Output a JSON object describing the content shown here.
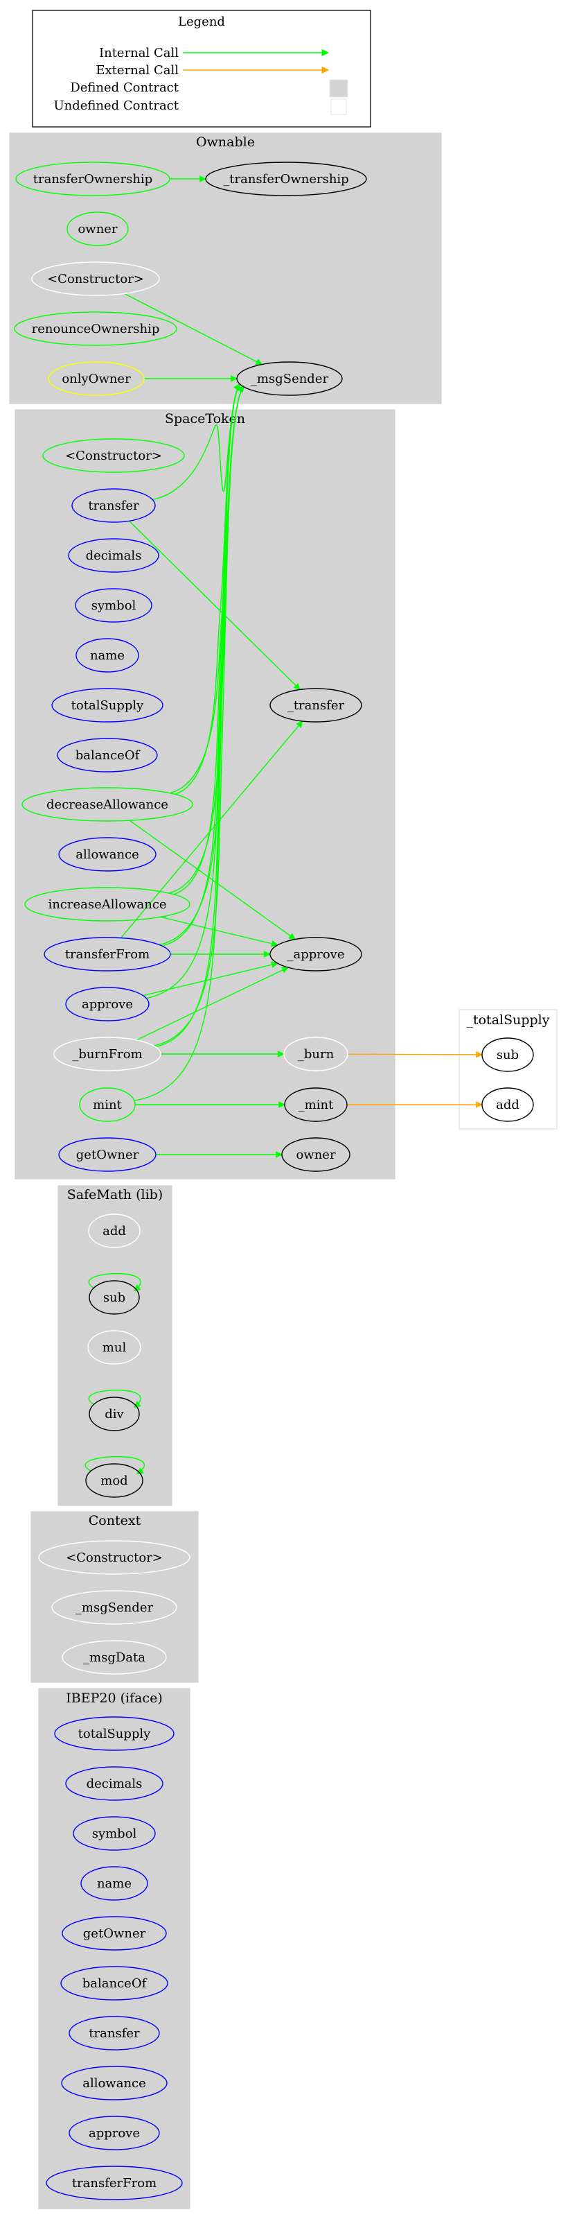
{
  "legend": {
    "title": "Legend",
    "items": [
      {
        "label": "Internal Call",
        "kind": "internal"
      },
      {
        "label": "External Call",
        "kind": "external"
      },
      {
        "label": "Defined Contract",
        "kind": "defined"
      },
      {
        "label": "Undefined Contract",
        "kind": "undefined"
      }
    ]
  },
  "colors": {
    "internal_call": "#00ff00",
    "external_call": "#ffa500",
    "cluster_fill": "#d3d3d3",
    "external_cluster_border": "#e0e0e0",
    "node_public": "#0000ff",
    "node_internal_call": "#00ff00",
    "node_modifier": "#ffff00",
    "node_private": "#ffffff",
    "node_undefined": "#000000"
  },
  "clusters": [
    {
      "id": "Ownable",
      "label": "Ownable",
      "defined": true
    },
    {
      "id": "SpaceToken",
      "label": "SpaceToken",
      "defined": true
    },
    {
      "id": "_totalSupply",
      "label": "_totalSupply",
      "defined": false
    },
    {
      "id": "SafeMath",
      "label": "SafeMath  (lib)",
      "defined": true
    },
    {
      "id": "Context",
      "label": "Context",
      "defined": true
    },
    {
      "id": "IBEP20",
      "label": "IBEP20  (iface)",
      "defined": true
    }
  ],
  "nodes": [
    {
      "id": "own_transferOwnership",
      "cluster": "Ownable",
      "label": "transferOwnership",
      "stroke": "green"
    },
    {
      "id": "own__transferOwnership",
      "cluster": "Ownable",
      "label": "_transferOwnership",
      "stroke": "black"
    },
    {
      "id": "own_owner",
      "cluster": "Ownable",
      "label": "owner",
      "stroke": "green"
    },
    {
      "id": "own_ctor",
      "cluster": "Ownable",
      "label": "<Constructor>",
      "stroke": "white"
    },
    {
      "id": "own_renounce",
      "cluster": "Ownable",
      "label": "renounceOwnership",
      "stroke": "green"
    },
    {
      "id": "own_onlyOwner",
      "cluster": "Ownable",
      "label": "onlyOwner",
      "stroke": "yellow"
    },
    {
      "id": "own__msgSender",
      "cluster": "Ownable",
      "label": "_msgSender",
      "stroke": "black"
    },
    {
      "id": "st_ctor",
      "cluster": "SpaceToken",
      "label": "<Constructor>",
      "stroke": "green"
    },
    {
      "id": "st_transfer",
      "cluster": "SpaceToken",
      "label": "transfer",
      "stroke": "blue"
    },
    {
      "id": "st_decimals",
      "cluster": "SpaceToken",
      "label": "decimals",
      "stroke": "blue"
    },
    {
      "id": "st_symbol",
      "cluster": "SpaceToken",
      "label": "symbol",
      "stroke": "blue"
    },
    {
      "id": "st_name",
      "cluster": "SpaceToken",
      "label": "name",
      "stroke": "blue"
    },
    {
      "id": "st_totalSupply",
      "cluster": "SpaceToken",
      "label": "totalSupply",
      "stroke": "blue"
    },
    {
      "id": "st_balanceOf",
      "cluster": "SpaceToken",
      "label": "balanceOf",
      "stroke": "blue"
    },
    {
      "id": "st_decreaseAllowance",
      "cluster": "SpaceToken",
      "label": "decreaseAllowance",
      "stroke": "green"
    },
    {
      "id": "st_allowance",
      "cluster": "SpaceToken",
      "label": "allowance",
      "stroke": "blue"
    },
    {
      "id": "st_increaseAllowance",
      "cluster": "SpaceToken",
      "label": "increaseAllowance",
      "stroke": "green"
    },
    {
      "id": "st_transferFrom",
      "cluster": "SpaceToken",
      "label": "transferFrom",
      "stroke": "blue"
    },
    {
      "id": "st_approve",
      "cluster": "SpaceToken",
      "label": "approve",
      "stroke": "blue"
    },
    {
      "id": "st__burnFrom",
      "cluster": "SpaceToken",
      "label": "_burnFrom",
      "stroke": "white"
    },
    {
      "id": "st_mint",
      "cluster": "SpaceToken",
      "label": "mint",
      "stroke": "green"
    },
    {
      "id": "st_getOwner",
      "cluster": "SpaceToken",
      "label": "getOwner",
      "stroke": "blue"
    },
    {
      "id": "st__transfer",
      "cluster": "SpaceToken",
      "label": "_transfer",
      "stroke": "black"
    },
    {
      "id": "st__approve",
      "cluster": "SpaceToken",
      "label": "_approve",
      "stroke": "black"
    },
    {
      "id": "st__burn",
      "cluster": "SpaceToken",
      "label": "_burn",
      "stroke": "white"
    },
    {
      "id": "st__mint",
      "cluster": "SpaceToken",
      "label": "_mint",
      "stroke": "black"
    },
    {
      "id": "st_owner",
      "cluster": "SpaceToken",
      "label": "owner",
      "stroke": "black"
    },
    {
      "id": "ts_sub",
      "cluster": "_totalSupply",
      "label": "sub",
      "stroke": "black"
    },
    {
      "id": "ts_add",
      "cluster": "_totalSupply",
      "label": "add",
      "stroke": "black"
    },
    {
      "id": "sm_add",
      "cluster": "SafeMath",
      "label": "add",
      "stroke": "white"
    },
    {
      "id": "sm_sub",
      "cluster": "SafeMath",
      "label": "sub",
      "stroke": "black"
    },
    {
      "id": "sm_mul",
      "cluster": "SafeMath",
      "label": "mul",
      "stroke": "white"
    },
    {
      "id": "sm_div",
      "cluster": "SafeMath",
      "label": "div",
      "stroke": "black"
    },
    {
      "id": "sm_mod",
      "cluster": "SafeMath",
      "label": "mod",
      "stroke": "black"
    },
    {
      "id": "ctx_ctor",
      "cluster": "Context",
      "label": "<Constructor>",
      "stroke": "white"
    },
    {
      "id": "ctx__msgSender",
      "cluster": "Context",
      "label": "_msgSender",
      "stroke": "white"
    },
    {
      "id": "ctx__msgData",
      "cluster": "Context",
      "label": "_msgData",
      "stroke": "white"
    },
    {
      "id": "ib_totalSupply",
      "cluster": "IBEP20",
      "label": "totalSupply",
      "stroke": "blue"
    },
    {
      "id": "ib_decimals",
      "cluster": "IBEP20",
      "label": "decimals",
      "stroke": "blue"
    },
    {
      "id": "ib_symbol",
      "cluster": "IBEP20",
      "label": "symbol",
      "stroke": "blue"
    },
    {
      "id": "ib_name",
      "cluster": "IBEP20",
      "label": "name",
      "stroke": "blue"
    },
    {
      "id": "ib_getOwner",
      "cluster": "IBEP20",
      "label": "getOwner",
      "stroke": "blue"
    },
    {
      "id": "ib_balanceOf",
      "cluster": "IBEP20",
      "label": "balanceOf",
      "stroke": "blue"
    },
    {
      "id": "ib_transfer",
      "cluster": "IBEP20",
      "label": "transfer",
      "stroke": "blue"
    },
    {
      "id": "ib_allowance",
      "cluster": "IBEP20",
      "label": "allowance",
      "stroke": "blue"
    },
    {
      "id": "ib_approve",
      "cluster": "IBEP20",
      "label": "approve",
      "stroke": "blue"
    },
    {
      "id": "ib_transferFrom",
      "cluster": "IBEP20",
      "label": "transferFrom",
      "stroke": "blue"
    }
  ],
  "edges": [
    {
      "from": "own_transferOwnership",
      "to": "own__transferOwnership",
      "type": "internal"
    },
    {
      "from": "own_ctor",
      "to": "own__msgSender",
      "type": "internal"
    },
    {
      "from": "own_onlyOwner",
      "to": "own__msgSender",
      "type": "internal"
    },
    {
      "from": "st_transfer",
      "to": "own__msgSender",
      "type": "internal"
    },
    {
      "from": "st_transfer",
      "to": "st__transfer",
      "type": "internal"
    },
    {
      "from": "st_decreaseAllowance",
      "to": "own__msgSender",
      "type": "internal"
    },
    {
      "from": "st_decreaseAllowance",
      "to": "own__msgSender",
      "type": "internal"
    },
    {
      "from": "st_decreaseAllowance",
      "to": "st__approve",
      "type": "internal"
    },
    {
      "from": "st_increaseAllowance",
      "to": "own__msgSender",
      "type": "internal"
    },
    {
      "from": "st_increaseAllowance",
      "to": "own__msgSender",
      "type": "internal"
    },
    {
      "from": "st_increaseAllowance",
      "to": "st__approve",
      "type": "internal"
    },
    {
      "from": "st_transferFrom",
      "to": "own__msgSender",
      "type": "internal"
    },
    {
      "from": "st_transferFrom",
      "to": "own__msgSender",
      "type": "internal"
    },
    {
      "from": "st_transferFrom",
      "to": "st__transfer",
      "type": "internal"
    },
    {
      "from": "st_transferFrom",
      "to": "st__approve",
      "type": "internal"
    },
    {
      "from": "st_approve",
      "to": "own__msgSender",
      "type": "internal"
    },
    {
      "from": "st_approve",
      "to": "st__approve",
      "type": "internal"
    },
    {
      "from": "st__burnFrom",
      "to": "own__msgSender",
      "type": "internal"
    },
    {
      "from": "st__burnFrom",
      "to": "own__msgSender",
      "type": "internal"
    },
    {
      "from": "st__burnFrom",
      "to": "st__approve",
      "type": "internal"
    },
    {
      "from": "st__burnFrom",
      "to": "st__burn",
      "type": "internal"
    },
    {
      "from": "st_mint",
      "to": "own__msgSender",
      "type": "internal"
    },
    {
      "from": "st_mint",
      "to": "st__mint",
      "type": "internal"
    },
    {
      "from": "st_getOwner",
      "to": "st_owner",
      "type": "internal"
    },
    {
      "from": "st__burn",
      "to": "ts_sub",
      "type": "external"
    },
    {
      "from": "st__mint",
      "to": "ts_add",
      "type": "external"
    },
    {
      "from": "sm_sub",
      "to": "sm_sub",
      "type": "internal"
    },
    {
      "from": "sm_div",
      "to": "sm_div",
      "type": "internal"
    },
    {
      "from": "sm_mod",
      "to": "sm_mod",
      "type": "internal"
    }
  ]
}
